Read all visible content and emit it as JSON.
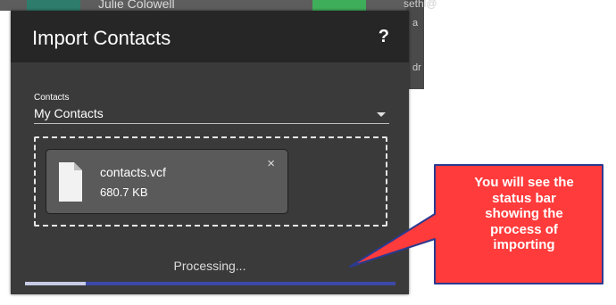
{
  "background": {
    "contact_name": "Julie Colowell",
    "contact_email": "sethl@",
    "fragment_a": "a",
    "fragment_b": "dr"
  },
  "dialog": {
    "title": "Import Contacts",
    "help_label": "?",
    "contacts_label": "Contacts",
    "contacts_selected": "My Contacts",
    "file": {
      "name": "contacts.vcf",
      "size": "680.7 KB",
      "close_label": "×"
    },
    "status_text": "Processing...",
    "progress_fraction": 0.165
  },
  "annotation": {
    "lines": [
      "You will see the",
      "status bar",
      "showing the",
      "process of",
      "importing"
    ]
  },
  "colors": {
    "dialog_bg": "#3a3a3a",
    "header_bg": "#262626",
    "progress_track": "#3c49a8",
    "progress_fill": "#c8cbe4",
    "callout_fill": "#ff3b3b",
    "callout_border": "#2b3a8f"
  },
  "icons": {
    "file": "file-icon",
    "caret": "chevron-down-icon",
    "close": "close-icon"
  }
}
